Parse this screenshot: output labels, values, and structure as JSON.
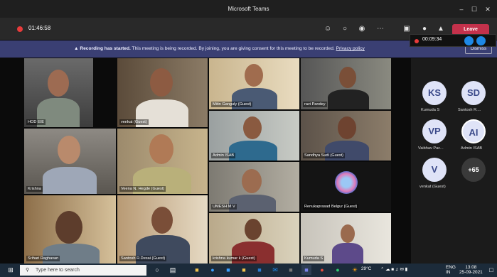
{
  "window": {
    "title": "Microsoft Teams",
    "controls": [
      "–",
      "☐",
      "✕"
    ]
  },
  "toolbar": {
    "timer": "01:46:58",
    "leave_label": "Leave"
  },
  "recording": {
    "elapsed": "00:09:34"
  },
  "banner": {
    "bold": "Recording has started.",
    "text": "This meeting is being recorded. By joining, you are giving consent for this meeting to be recorded.",
    "link": "Privacy policy",
    "dismiss": "Dismiss"
  },
  "tiles": [
    {
      "name": "HOD EIE"
    },
    {
      "name": "venkat (Guest)"
    },
    {
      "name": "Mitin Ganguly (Guest)"
    },
    {
      "name": "ravi Pandey"
    },
    {
      "name": "Krishna"
    },
    {
      "name": "Veena N. Hegde (Guest)"
    },
    {
      "name": "Admin ISAB"
    },
    {
      "name": "Sandhya Sudi (Guest)"
    },
    {
      "name": "UMESH M V"
    },
    {
      "name": "Renukaprasad Belgur (Guest)"
    },
    {
      "name": "Srihari Raghavan"
    },
    {
      "name": "Santosh R.Desai (Guest)"
    },
    {
      "name": "krishna kumar k (Guest)"
    },
    {
      "name": "Kumuda S"
    },
    {
      "name": ""
    }
  ],
  "roster": [
    {
      "initials": "KS",
      "name": "Kumuda S"
    },
    {
      "initials": "SD",
      "name": "Santosh R...."
    },
    {
      "initials": "VP",
      "name": "Vaibhav Pac..."
    },
    {
      "initials": "AI",
      "name": "Admin ISAB"
    },
    {
      "initials": "V",
      "name": "venkat (Guest)"
    },
    {
      "initials": "+65",
      "name": ""
    }
  ],
  "taskbar": {
    "search_placeholder": "Type here to search",
    "weather": "29°C",
    "lang": "ENG",
    "region": "IN",
    "time": "13:08",
    "date": "25-09-2021"
  }
}
